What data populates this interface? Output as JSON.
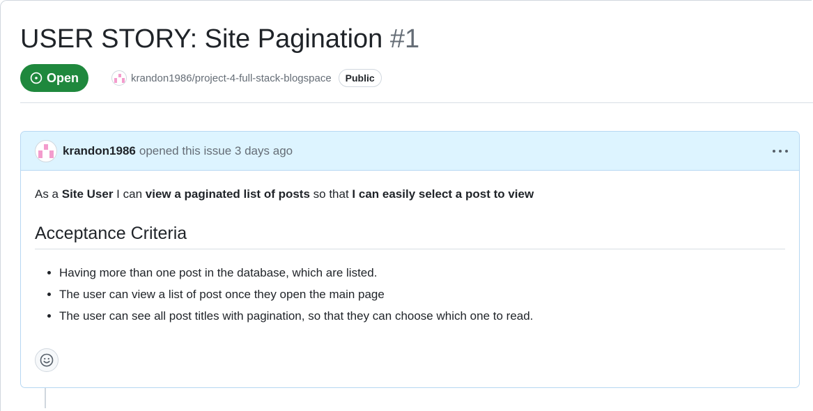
{
  "issue": {
    "title": "USER STORY: Site Pagination",
    "number": "#1",
    "state": "Open",
    "repo": "krandon1986/project-4-full-stack-blogspace",
    "visibility": "Public"
  },
  "comment": {
    "author": "krandon1986",
    "meta": "opened this issue 3 days ago",
    "lead": {
      "t1": "As a ",
      "b1": "Site User",
      "t2": " I can ",
      "b2": "view a paginated list of posts",
      "t3": " so that ",
      "b3": "I can easily select a post to view"
    },
    "heading": "Acceptance Criteria",
    "criteria": [
      "Having more than one post in the database, which are listed.",
      "The user can view a list of post once they open the main page",
      "The user can see all post titles with pagination, so that they can choose which one to read."
    ]
  },
  "icons": {
    "state": "issue-opened-icon",
    "menu": "kebab-horizontal-icon",
    "reaction": "smiley-icon"
  },
  "colors": {
    "open_green": "#1f883d",
    "comment_header_bg": "#ddf4ff",
    "comment_border": "#b6d7f2",
    "muted_text": "#656d76"
  }
}
